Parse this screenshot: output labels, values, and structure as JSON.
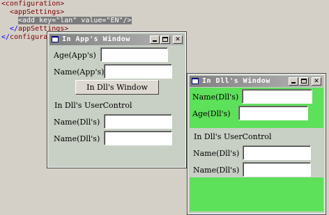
{
  "xml": {
    "line1": "<configuration>",
    "line2": "<appSettings>",
    "line3": "<add key=\"lan\" value=\"EN\"/>",
    "line4_prefix": "</",
    "line4": "appSettings>",
    "line5_prefix": "</",
    "line5": "configuration>"
  },
  "app_window": {
    "title": "In App's Window",
    "age_label": "Age(App's)",
    "age_value": "",
    "name_label": "Name(App's)",
    "name_value": "",
    "open_button": "In Dll's Window",
    "usercontrol_caption": "In Dll's UserControl",
    "uc_name1_label": "Name(Dll's)",
    "uc_name1_value": "",
    "uc_name2_label": "Name(Dll's)",
    "uc_name2_value": ""
  },
  "dll_window": {
    "title": "In Dll's Window",
    "name_label": "Name(Dll's)",
    "name_value": "",
    "age_label": "Age(Dll's)",
    "age_value": "",
    "usercontrol_caption": "In Dll's UserControl",
    "uc_name1_label": "Name(Dll's)",
    "uc_name1_value": "",
    "uc_name2_label": "Name(Dll's)",
    "uc_name2_value": ""
  },
  "colors": {
    "desktop": "#d4d0c8",
    "form_back": "#5de05a",
    "usercontrol_back": "#c8cfc4",
    "titlebar_inactive": "#808080",
    "xml_tag": "#800000",
    "xml_highlight": "#7b7b7b"
  },
  "icons": {
    "app_icon": "window-icon",
    "minimize": "minimize-icon",
    "maximize": "maximize-icon",
    "close": "close-icon"
  },
  "glyphs": {
    "close": "✕"
  }
}
